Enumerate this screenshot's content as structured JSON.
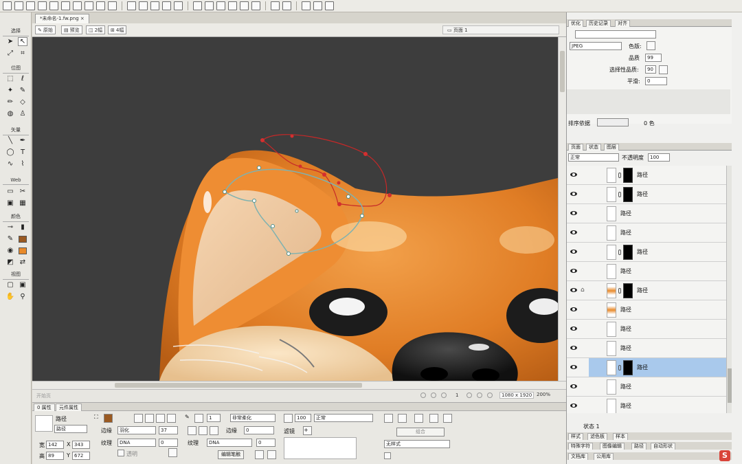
{
  "document_tab": {
    "title": "*未命名-1.fw.png",
    "close": "×"
  },
  "view_bar": {
    "original": "原始",
    "preview": "预览",
    "two_up": "2幅",
    "four_up": "4幅",
    "page": "页面 1"
  },
  "status_bar": {
    "frame_label": "开始页",
    "frame_number": "1",
    "dimensions": "1080 x 1920",
    "zoom": "200%"
  },
  "tool_sections": [
    "选择",
    "位图",
    "矢量",
    "Web",
    "颜色",
    "视图"
  ],
  "colors": {
    "stroke_brown": "#9a5a22",
    "fill_orange": "#e88a2b",
    "selection_blue": "#a9c9ec",
    "canvas": "#3d3d3d"
  },
  "properties": {
    "tabs": [
      "0 属性",
      "元件属性"
    ],
    "object_type": "路径",
    "object_name": "路径",
    "w_label": "宽",
    "w": "142",
    "x_label": "X",
    "x": "343",
    "h_label": "高",
    "h": "89",
    "y_label": "Y",
    "y": "672",
    "stroke_size": "1",
    "stroke_type": "非常柔化",
    "edge_label": "边缘",
    "edge_value": "羽化",
    "edge_amount": "37",
    "texture_label": "纹理",
    "texture_value": "DNA",
    "texture_amount": "0",
    "transparent_label": "透明",
    "stroke_texture_label": "纹理",
    "stroke_texture_value": "DNA",
    "stroke_texture_amount": "0",
    "stroke_edge_label": "边缘",
    "stroke_edge_value": "0",
    "edit_stroke_button": "编辑笔触",
    "opacity": "100",
    "blend_mode": "正常",
    "filters_label": "滤镜",
    "combine_button": "组合",
    "style_value": "无样式"
  },
  "right_panel": {
    "top_tabs": [
      "优化",
      "历史记录",
      "对齐"
    ],
    "format": "JPEG",
    "matte_label": "色版:",
    "quality_label": "品质",
    "quality_value": "99",
    "selective_quality_label": "选择性品质:",
    "selective_quality_value": "90",
    "smoothing_label": "平滑:",
    "smoothing_value": "0",
    "sort_label": "排序依据",
    "colors_count": "0 色",
    "layer_tabs": [
      "页面",
      "状态",
      "图层"
    ],
    "blend_mode": "正常",
    "opacity_label": "不透明度",
    "opacity_value": "100",
    "state_label": "状态 1",
    "bottom_tabs_1": [
      "样式",
      "滤色板",
      "样本"
    ],
    "bottom_tabs_2": [
      "特殊字符",
      "图像编辑",
      "路径",
      "自动形状"
    ],
    "bottom_tabs_3": [
      "文档库",
      "公用库"
    ]
  },
  "layers": [
    {
      "name": "路径",
      "mask": true,
      "lock": false,
      "thumb": "white",
      "selected": false
    },
    {
      "name": "路径",
      "mask": true,
      "lock": false,
      "thumb": "white",
      "selected": false
    },
    {
      "name": "路径",
      "mask": false,
      "lock": false,
      "thumb": "white",
      "selected": false
    },
    {
      "name": "路径",
      "mask": false,
      "lock": false,
      "thumb": "white",
      "selected": false
    },
    {
      "name": "路径",
      "mask": true,
      "lock": false,
      "thumb": "white",
      "selected": false
    },
    {
      "name": "路径",
      "mask": false,
      "lock": false,
      "thumb": "white",
      "selected": false
    },
    {
      "name": "路径",
      "mask": true,
      "lock": true,
      "thumb": "orange",
      "selected": false
    },
    {
      "name": "路径",
      "mask": false,
      "lock": false,
      "thumb": "orange",
      "selected": false
    },
    {
      "name": "路径",
      "mask": false,
      "lock": false,
      "thumb": "white",
      "selected": false
    },
    {
      "name": "路径",
      "mask": false,
      "lock": false,
      "thumb": "white",
      "selected": false
    },
    {
      "name": "路径",
      "mask": true,
      "lock": false,
      "thumb": "white",
      "selected": true
    },
    {
      "name": "路径",
      "mask": false,
      "lock": false,
      "thumb": "white",
      "selected": false
    },
    {
      "name": "路径",
      "mask": false,
      "lock": false,
      "thumb": "white",
      "selected": false
    },
    {
      "name": "",
      "mask": true,
      "lock": false,
      "thumb": "white",
      "selected": false
    }
  ]
}
